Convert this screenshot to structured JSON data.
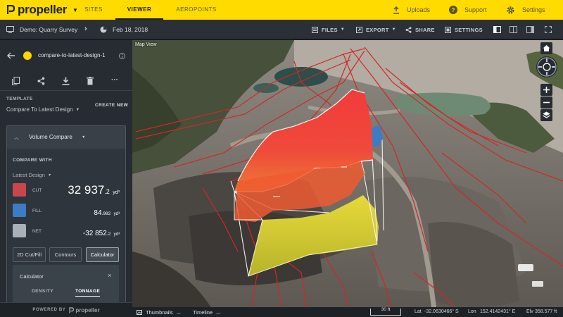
{
  "topbar": {
    "logo_text": "propeller",
    "tabs": [
      {
        "label": "SITES",
        "active": false
      },
      {
        "label": "VIEWER",
        "active": true
      },
      {
        "label": "AEROPOINTS",
        "active": false
      }
    ],
    "actions": [
      {
        "label": "Uploads",
        "icon": "upload-icon"
      },
      {
        "label": "Support",
        "icon": "help-icon"
      },
      {
        "label": "Settings",
        "icon": "gear-icon"
      }
    ],
    "accent_color": "#ffdb00"
  },
  "subbar": {
    "project": "Demo: Quarry Survey",
    "date": "Feb 18, 2018",
    "tools": [
      {
        "label": "FILES",
        "icon": "files-icon",
        "has_caret": true
      },
      {
        "label": "EXPORT",
        "icon": "export-icon",
        "has_caret": true
      },
      {
        "label": "SHARE",
        "icon": "share-icon",
        "has_caret": false
      },
      {
        "label": "SETTINGS",
        "icon": "settings-sliders-icon",
        "has_caret": false
      }
    ]
  },
  "panel": {
    "layer_name": "compare-to-latest-design-1",
    "layer_color": "#ffd600",
    "template_label": "TEMPLATE",
    "template_value": "Compare To Latest Design",
    "create_new": "CREATE NEW",
    "tool_name": "Volume Compare",
    "compare_with_label": "COMPARE WITH",
    "compare_with_value": "Latest Design",
    "volumes": [
      {
        "label": "CUT",
        "value_main": "32 937",
        "value_dec": ".2",
        "unit": "yd³",
        "color": "#c9474c"
      },
      {
        "label": "FILL",
        "value_main": "84",
        "value_dec": ".982",
        "unit": "yd³",
        "color": "#3d7cc4"
      },
      {
        "label": "NET",
        "value_main": "-32 852",
        "value_dec": ".2",
        "unit": "yd³",
        "color": "#a9b0b7"
      }
    ],
    "buttons": [
      {
        "label": "2D Cut/Fill",
        "active": false
      },
      {
        "label": "Contours",
        "active": false
      },
      {
        "label": "Calculator",
        "active": true
      }
    ],
    "calculator": {
      "title": "Calculator",
      "tabs": [
        {
          "label": "DENSITY",
          "active": false
        },
        {
          "label": "TONNAGE",
          "active": true
        }
      ]
    },
    "powered_by": "POWERED BY",
    "powered_brand": "propeller"
  },
  "viewport": {
    "map_view_label": "Map View"
  },
  "bottombar": {
    "thumbnails": "Thumbnails",
    "timeline": "Timeline",
    "scale": "30 ft",
    "lat_label": "Lat",
    "lat_value": "-32.0630466° S",
    "lon_label": "Lon",
    "lon_value": "152.4142431° E",
    "elv_label": "Elv",
    "elv_value": "358.577 ft"
  }
}
